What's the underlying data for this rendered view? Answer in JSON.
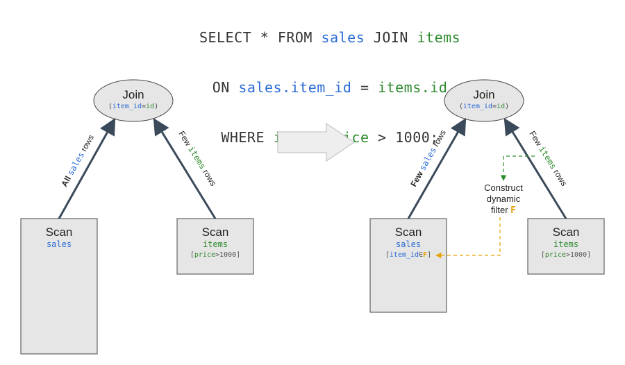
{
  "sql": {
    "line1": {
      "select": "SELECT",
      "star": " * ",
      "from": "FROM ",
      "tblA": "sales",
      "sp1": " ",
      "join": "JOIN",
      "sp2": " ",
      "tblB": "items"
    },
    "line2": {
      "on": "ON ",
      "a": "sales.item_id",
      "eq": " = ",
      "b": "items.id"
    },
    "line3": {
      "where": "WHERE ",
      "col": "items.price",
      "gt": " > 1000;"
    }
  },
  "left": {
    "join": {
      "title": "Join",
      "sub": {
        "open": "(",
        "a": "item_id",
        "eq": "=",
        "b": "id",
        "close": ")"
      }
    },
    "edgeA": {
      "pre": "All ",
      "tbl": "sales",
      "post": " rows"
    },
    "edgeB": {
      "pre": "Few ",
      "tbl": "items",
      "post": " rows"
    },
    "scanA": {
      "title": "Scan",
      "tbl": "sales"
    },
    "scanB": {
      "title": "Scan",
      "tbl": "items",
      "pred": {
        "open": "[",
        "col": "price",
        "rest": ">1000",
        "close": "]"
      }
    }
  },
  "right": {
    "join": {
      "title": "Join",
      "sub": {
        "open": "(",
        "a": "item_id",
        "eq": "=",
        "b": "id",
        "close": ")"
      }
    },
    "edgeA": {
      "pre": "Few ",
      "tbl": "sales",
      "post": " rows"
    },
    "edgeB": {
      "pre": "Few ",
      "tbl": "items",
      "post": " rows"
    },
    "scanA": {
      "title": "Scan",
      "tbl": "sales",
      "pred": {
        "open": "[",
        "col": "item_id",
        "in": "∈",
        "f": "F",
        "close": "]"
      }
    },
    "scanB": {
      "title": "Scan",
      "tbl": "items",
      "pred": {
        "open": "[",
        "col": "price",
        "rest": ">1000",
        "close": "]"
      }
    },
    "dynamic": {
      "l1": "Construct",
      "l2": "dynamic",
      "l3a": "filter ",
      "l3b": "F"
    }
  }
}
